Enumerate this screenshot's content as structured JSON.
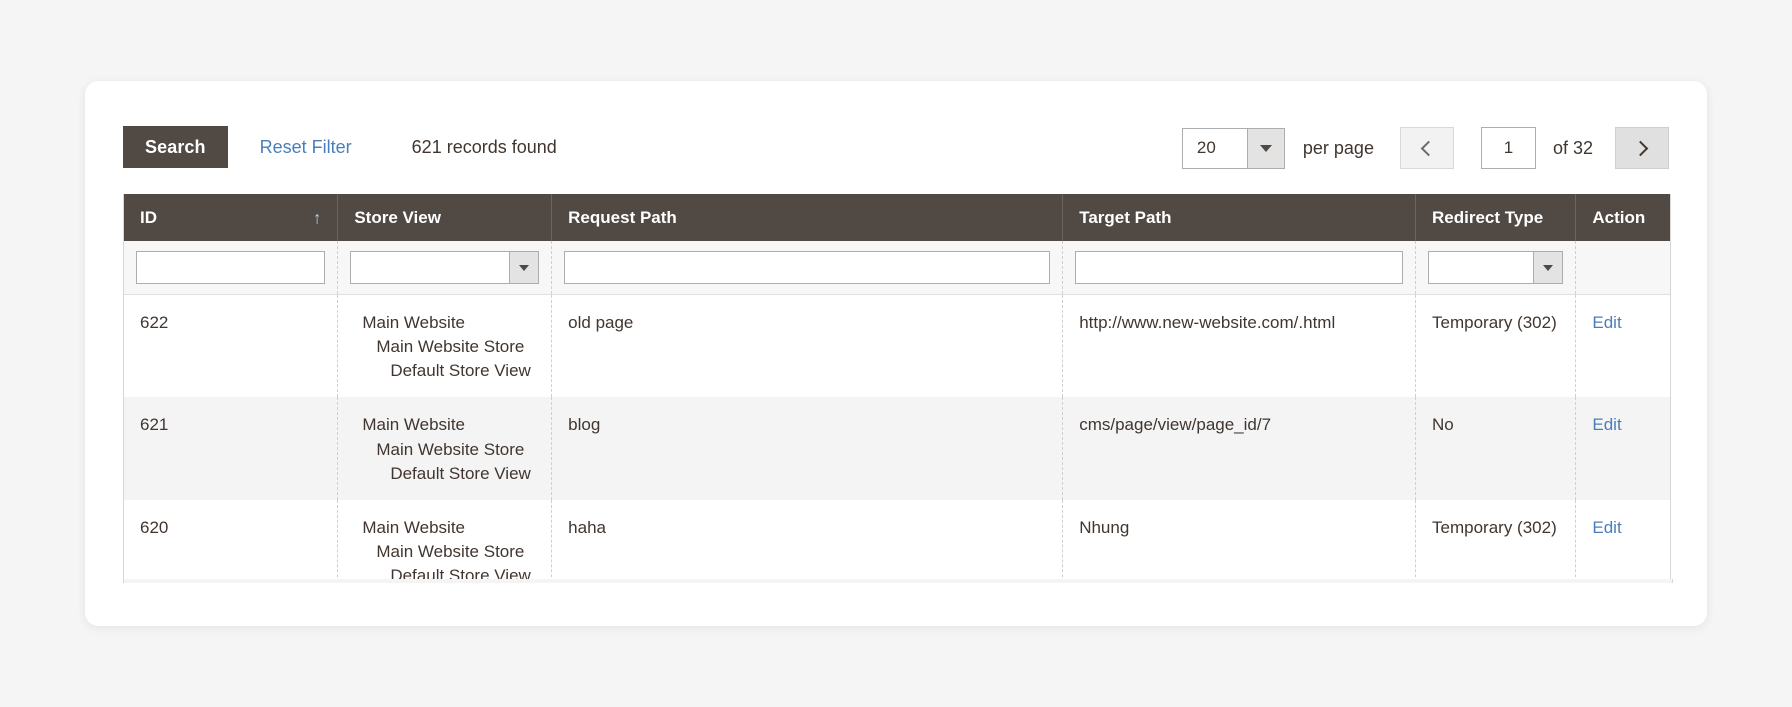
{
  "toolbar": {
    "search_label": "Search",
    "reset_filter_label": "Reset Filter",
    "records_found": "621 records found"
  },
  "pagination": {
    "per_page_value": "20",
    "per_page_label": "per page",
    "prev_icon": "chevron-left-icon",
    "next_icon": "chevron-right-icon",
    "current_page": "1",
    "of_label": "of 32"
  },
  "grid": {
    "columns": [
      {
        "label": "ID",
        "sorted": true,
        "sort_icon": "↑"
      },
      {
        "label": "Store View",
        "sorted": false
      },
      {
        "label": "Request Path",
        "sorted": false
      },
      {
        "label": "Target Path",
        "sorted": false
      },
      {
        "label": "Redirect Type",
        "sorted": false
      },
      {
        "label": "Action",
        "sorted": false
      }
    ],
    "filters": {
      "id": "",
      "store_view": "",
      "request_path": "",
      "target_path": "",
      "redirect_type": ""
    },
    "rows": [
      {
        "id": "622",
        "store_view": [
          "Main Website",
          "Main Website Store",
          "Default Store View"
        ],
        "request_path": "old page",
        "target_path": "http://www.new-website.com/.html",
        "redirect_type": "Temporary (302)",
        "action": "Edit"
      },
      {
        "id": "621",
        "store_view": [
          "Main Website",
          "Main Website Store",
          "Default Store View"
        ],
        "request_path": "blog",
        "target_path": "cms/page/view/page_id/7",
        "redirect_type": "No",
        "action": "Edit"
      },
      {
        "id": "620",
        "store_view": [
          "Main Website",
          "Main Website Store",
          "Default Store View"
        ],
        "request_path": "haha",
        "target_path": "Nhung",
        "redirect_type": "Temporary (302)",
        "action": "Edit"
      }
    ]
  },
  "colors": {
    "header_bg": "#514943",
    "link": "#4a7ebb",
    "page_bg": "#f5f5f5",
    "stripe": "#f4f4f4"
  }
}
